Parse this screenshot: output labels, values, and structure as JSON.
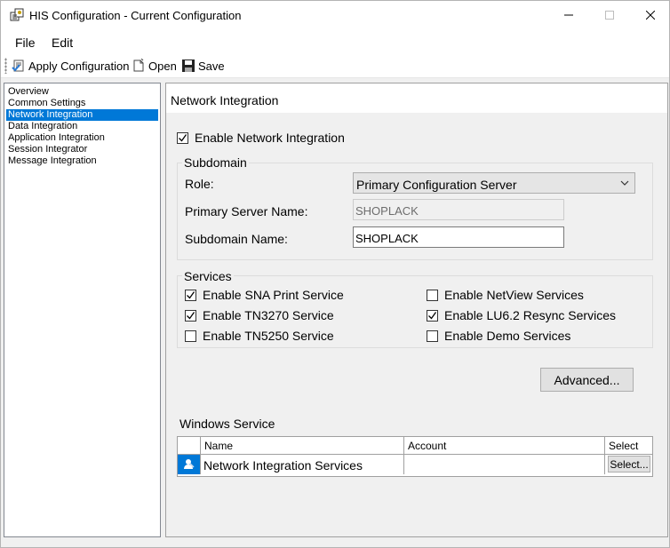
{
  "window": {
    "title": "HIS Configuration - Current Configuration"
  },
  "menu": {
    "file": "File",
    "edit": "Edit"
  },
  "toolbar": {
    "apply_label": "Apply Configuration",
    "open_label": "Open",
    "save_label": "Save"
  },
  "tree": {
    "items": [
      {
        "label": "Overview",
        "selected": false
      },
      {
        "label": "Common Settings",
        "selected": false
      },
      {
        "label": "Network Integration",
        "selected": true
      },
      {
        "label": "Data Integration",
        "selected": false
      },
      {
        "label": "Application Integration",
        "selected": false
      },
      {
        "label": "Session Integrator",
        "selected": false
      },
      {
        "label": "Message Integration",
        "selected": false
      }
    ]
  },
  "panel": {
    "title": "Network Integration",
    "enable_label": "Enable Network Integration",
    "enable_checked": true,
    "subdomain": {
      "group_label": "Subdomain",
      "role_label": "Role:",
      "role_value": "Primary Configuration Server",
      "primary_server_label": "Primary Server Name:",
      "primary_server_value": "SHOPLACK",
      "subdomain_name_label": "Subdomain Name:",
      "subdomain_name_value": "SHOPLACK"
    },
    "services": {
      "group_label": "Services",
      "items": [
        {
          "label": "Enable SNA Print Service",
          "checked": true
        },
        {
          "label": "Enable TN3270 Service",
          "checked": true
        },
        {
          "label": "Enable TN5250 Service",
          "checked": false
        },
        {
          "label": "Enable NetView Services",
          "checked": false
        },
        {
          "label": "Enable LU6.2 Resync Services",
          "checked": true
        },
        {
          "label": "Enable Demo Services",
          "checked": false
        }
      ]
    },
    "advanced_label": "Advanced...",
    "windows_service": {
      "label": "Windows Service",
      "columns": [
        "Name",
        "Account",
        "Select"
      ],
      "rows": [
        {
          "name": "Network Integration Services",
          "account": "",
          "select_label": "Select..."
        }
      ]
    }
  },
  "colors": {
    "selection": "#0078d7",
    "panel_bg": "#f0f0f0"
  }
}
